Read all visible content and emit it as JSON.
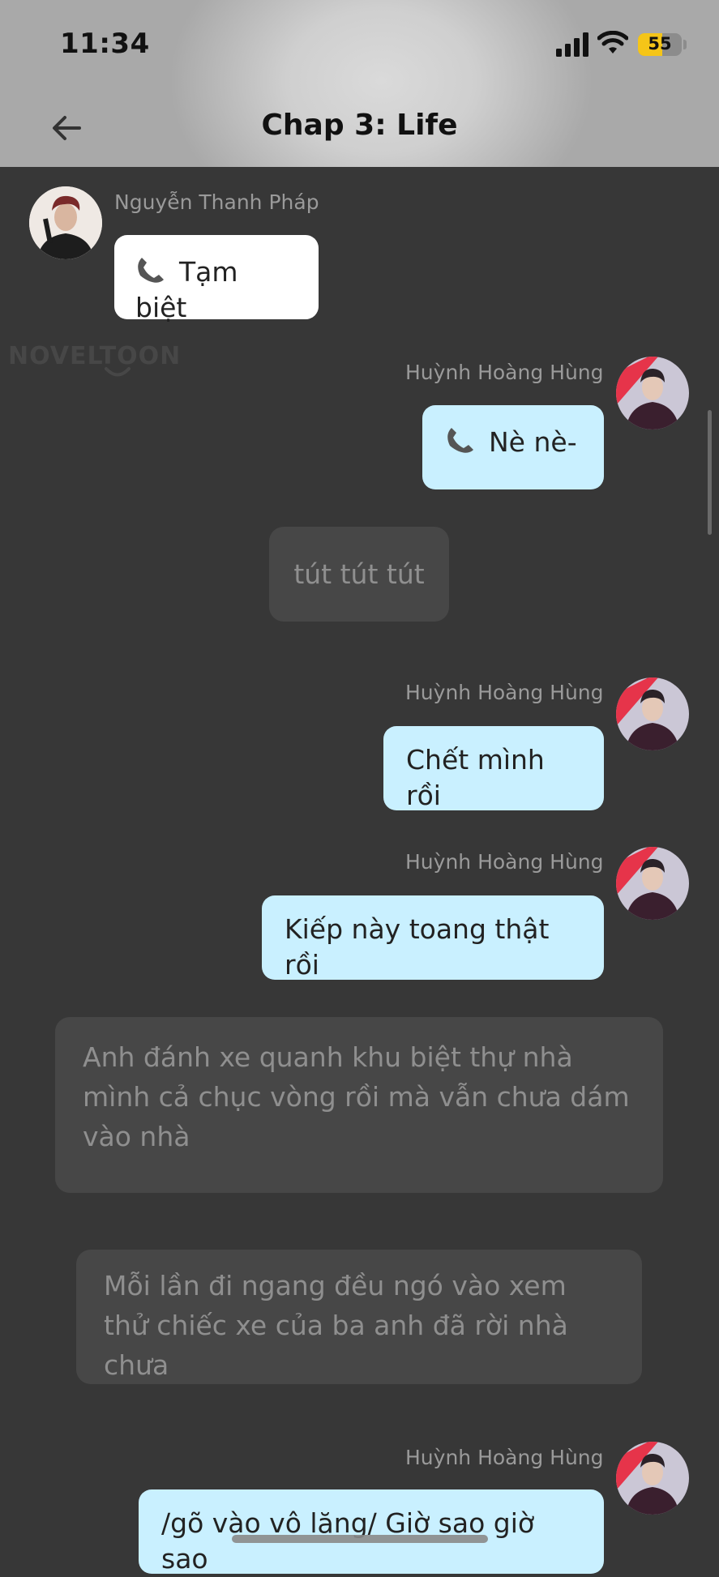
{
  "status_bar": {
    "time": "11:34",
    "battery": "55"
  },
  "header": {
    "title": "Chap 3: Life"
  },
  "watermark": "NOVELTOON",
  "messages": [
    {
      "name": "Nguyễn Thanh Pháp",
      "text": "Tạm biệt",
      "call": true
    },
    {
      "name": "Huỳnh Hoàng Hùng",
      "text": "Nè nè-",
      "call": true
    },
    {
      "text": "tút tút tút"
    },
    {
      "name": "Huỳnh Hoàng Hùng",
      "text": "Chết mình rồi"
    },
    {
      "name": "Huỳnh Hoàng Hùng",
      "text": "Kiếp này toang thật rồi"
    },
    {
      "text": "Anh đánh xe quanh khu biệt thự nhà mình cả chục vòng rồi mà vẫn chưa dám vào nhà"
    },
    {
      "text": "Mỗi lần đi ngang đều ngó vào xem thử chiếc xe của ba anh đã rời nhà chưa"
    },
    {
      "name": "Huỳnh Hoàng Hùng",
      "text": "/gõ vào vô lăng/ Giờ sao giờ sao"
    }
  ]
}
